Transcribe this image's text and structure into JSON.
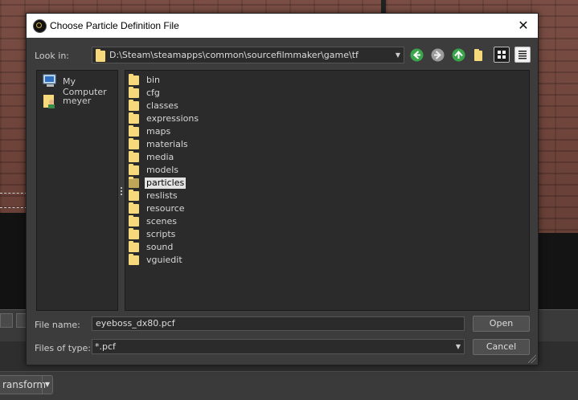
{
  "background": {
    "transform_button_label": "ransform"
  },
  "dialog": {
    "title": "Choose Particle Definition File",
    "look_in_label": "Look in:",
    "look_in_path": "D:\\Steam\\steamapps\\common\\sourcefilmmaker\\game\\tf",
    "sidebar": [
      {
        "label": "My Computer",
        "icon": "computer-icon"
      },
      {
        "label": "meyer",
        "icon": "user-icon"
      }
    ],
    "files": [
      {
        "name": "bin"
      },
      {
        "name": "cfg"
      },
      {
        "name": "classes"
      },
      {
        "name": "expressions"
      },
      {
        "name": "maps"
      },
      {
        "name": "materials"
      },
      {
        "name": "media"
      },
      {
        "name": "models"
      },
      {
        "name": "particles",
        "selected": true
      },
      {
        "name": "reslists"
      },
      {
        "name": "resource"
      },
      {
        "name": "scenes"
      },
      {
        "name": "scripts"
      },
      {
        "name": "sound"
      },
      {
        "name": "vguiedit"
      }
    ],
    "file_name_label": "File name:",
    "file_name_value": "eyeboss_dx80.pcf",
    "file_type_label": "Files of type:",
    "file_type_value": "*.pcf",
    "open_label": "Open",
    "cancel_label": "Cancel"
  },
  "colors": {
    "folder": "#f6d97a",
    "back_green": "#3aa54a",
    "up_green": "#3aa54a"
  }
}
